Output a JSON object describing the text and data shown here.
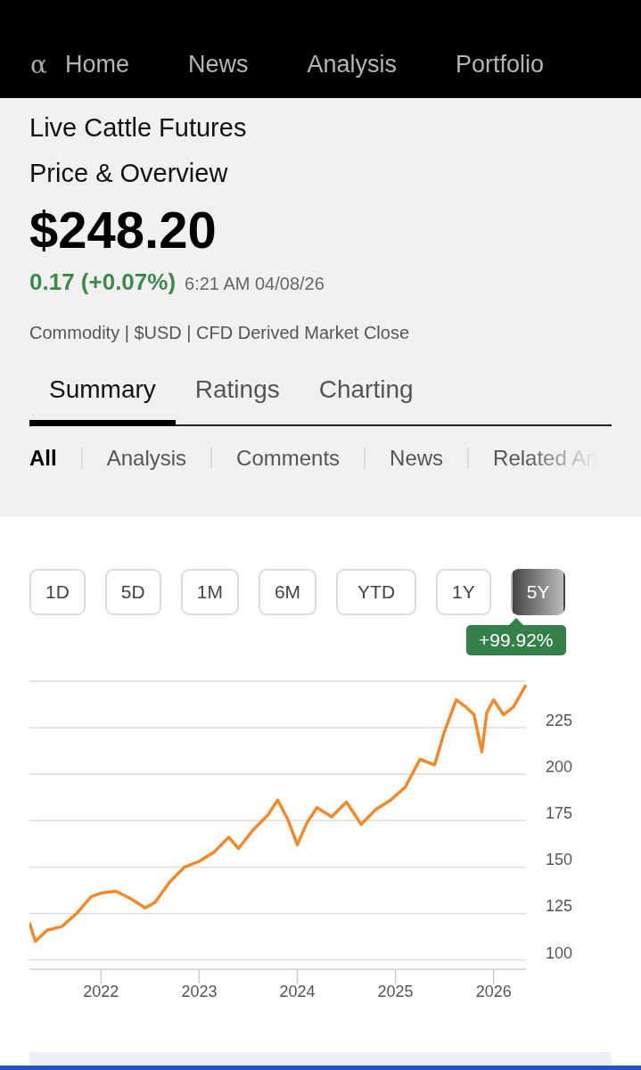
{
  "nav": {
    "logo": "α",
    "items": [
      {
        "label": "Home"
      },
      {
        "label": "News"
      },
      {
        "label": "Analysis"
      },
      {
        "label": "Portfolio"
      }
    ]
  },
  "title": "Live Cattle Futures",
  "subtitle": "Price & Overview",
  "price": "$248.20",
  "change": {
    "value": "0.17 (+0.07%)",
    "time": "6:21 AM 04/08/26"
  },
  "meta": "Commodity | $USD | CFD Derived Market Close",
  "tabs": [
    {
      "label": "Summary",
      "selected": true
    },
    {
      "label": "Ratings",
      "selected": false
    },
    {
      "label": "Charting",
      "selected": false
    }
  ],
  "filters": [
    {
      "label": "All",
      "selected": true
    },
    {
      "label": "Analysis",
      "selected": false
    },
    {
      "label": "Comments",
      "selected": false
    },
    {
      "label": "News",
      "selected": false
    },
    {
      "label": "Related An",
      "selected": false
    }
  ],
  "ranges": [
    {
      "label": "1D",
      "selected": false
    },
    {
      "label": "5D",
      "selected": false
    },
    {
      "label": "1M",
      "selected": false
    },
    {
      "label": "6M",
      "selected": false
    },
    {
      "label": "YTD",
      "selected": false
    },
    {
      "label": "1Y",
      "selected": false
    },
    {
      "label": "5Y",
      "selected": true
    }
  ],
  "range_change": "+99.92%",
  "chart_data": {
    "type": "line",
    "grid": true,
    "xlim": [
      2021.27,
      2026.33
    ],
    "ylim": [
      95,
      250
    ],
    "xticks": [
      2022,
      2023,
      2024,
      2025,
      2026
    ],
    "yticks": [
      100,
      125,
      150,
      175,
      200,
      225
    ],
    "series": [
      {
        "color": "#f08a2c",
        "x": [
          2021.27,
          2021.33,
          2021.45,
          2021.6,
          2021.75,
          2021.9,
          2022.0,
          2022.15,
          2022.3,
          2022.45,
          2022.55,
          2022.7,
          2022.85,
          2023.0,
          2023.15,
          2023.3,
          2023.4,
          2023.55,
          2023.7,
          2023.8,
          2023.9,
          2024.0,
          2024.1,
          2024.2,
          2024.35,
          2024.5,
          2024.65,
          2024.8,
          2024.95,
          2025.1,
          2025.25,
          2025.4,
          2025.5,
          2025.62,
          2025.72,
          2025.8,
          2025.88,
          2025.93,
          2026.0,
          2026.1,
          2026.2,
          2026.33
        ],
        "values": [
          120,
          110,
          116,
          118,
          125,
          134,
          136,
          137,
          133,
          128,
          131,
          142,
          150,
          153,
          158,
          166,
          160,
          170,
          178,
          186,
          176,
          162,
          174,
          182,
          177,
          185,
          173,
          181,
          186,
          193,
          208,
          205,
          223,
          240,
          236,
          232,
          212,
          233,
          240,
          232,
          236,
          248
        ]
      }
    ]
  }
}
